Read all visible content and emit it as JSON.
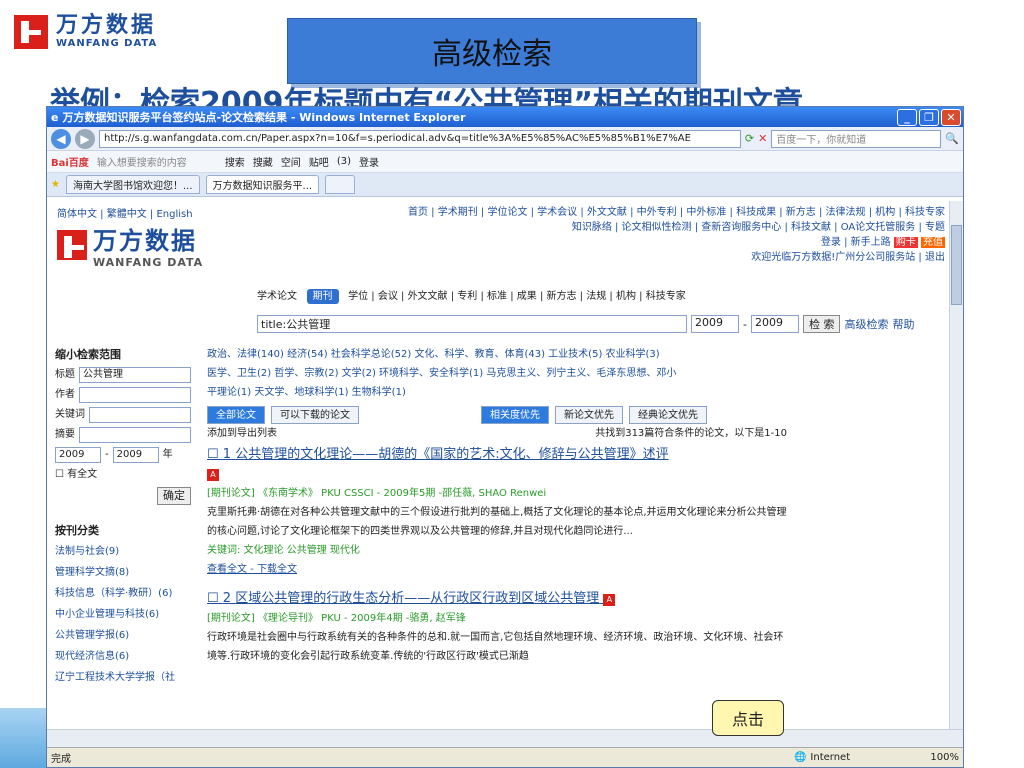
{
  "slide": {
    "logo_cn": "万方数据",
    "logo_en": "WANFANG DATA",
    "title": "高级检索",
    "subtitle": "举例：检索2009年标题中有“公共管理”相关的期刊文章"
  },
  "browser": {
    "window_title": "万方数据知识服务平台签约站点-论文检索结果 - Windows Internet Explorer",
    "url": "http://s.g.wanfangdata.com.cn/Paper.aspx?n=10&f=s.periodical.adv&q=title%3A%E5%85%AC%E5%85%B1%E7%AE",
    "search_placeholder": "百度一下，你就知道",
    "toolbar_items": [
      "Bai百度",
      "输入想要搜索的内容",
      "搜索",
      "搜藏",
      "空间",
      "贴吧",
      "(3)",
      "登录"
    ],
    "tabs": [
      "海南大学图书馆欢迎您！...",
      "万方数据知识服务平..."
    ],
    "status": "完成",
    "zone": "Internet",
    "zoom": "100%"
  },
  "site": {
    "langs": "简体中文 | 繁體中文 | English",
    "toplinks_1": "首页 | 学术期刊 | 学位论文 | 学术会议 | 外文文献 | 中外专利 | 中外标准 | 科技成果 | 新方志 | 法律法规 | 机构 | 科技专家",
    "toplinks_2": "知识脉络 | 论文相似性检测 | 查新咨询服务中心 | 科技文献 | OA论文托管服务 | 专题",
    "login": "登录",
    "newbie": "新手上路",
    "cart": "购卡",
    "recharge": "充值",
    "welcome": "欢迎光临万方数据!广州分公司服务站 | 退出",
    "channels": [
      "学术论文",
      "期刊",
      "学位",
      "会议",
      "外文文献",
      "专利",
      "标准",
      "成果",
      "新方志",
      "法规",
      "机构",
      "科技专家"
    ],
    "query": "title:公共管理",
    "year_from": "2009",
    "year_to": "2009",
    "search_btn": "检 索",
    "adv_link": "高级检索",
    "help_link": "帮助"
  },
  "sidebar": {
    "narrow_title": "缩小检索范围",
    "fields": [
      {
        "label": "标题",
        "value": "公共管理"
      },
      {
        "label": "作者",
        "value": ""
      },
      {
        "label": "关键词",
        "value": ""
      },
      {
        "label": "摘要",
        "value": ""
      }
    ],
    "year_from": "2009",
    "year_to": "2009",
    "year_unit": "年",
    "fulltext": "有全文",
    "confirm": "确定",
    "class_title": "按刊分类",
    "classes": [
      "法制与社会(9)",
      "管理科学文摘(8)",
      "科技信息（科学·教研）(6)",
      "中小企业管理与科技(6)",
      "公共管理学报(6)",
      "现代经济信息(6)",
      "辽宁工程技术大学学报（社"
    ]
  },
  "main": {
    "cat_line1": "政治、法律(140)  经济(54)  社会科学总论(52)  文化、科学、教育、体育(43)  工业技术(5)  农业科学(3)",
    "cat_line2": "医学、卫生(2)  哲学、宗教(2)  文学(2)  环境科学、安全科学(1)  马克思主义、列宁主义、毛泽东思想、邓小",
    "cat_line3": "平理论(1)  天文学、地球科学(1)  生物科学(1)",
    "tab_all": "全部论文",
    "tab_dl": "可以下载的论文",
    "sort_rel": "相关度优先",
    "sort_new": "新论文优先",
    "sort_classic": "经典论文优先",
    "export": "添加到导出列表",
    "count": "共找到313篇符合条件的论文，以下是1-10",
    "results": [
      {
        "num": "1",
        "title": "公共管理的文化理论——胡德的《国家的艺术:文化、修辞与公共管理》述评",
        "meta": "[期刊论文] 《东南学术》 PKU CSSCI - 2009年5期 -邵任薇, SHAO Renwei",
        "abstract": "克里斯托弗·胡德在对各种公共管理文献中的三个假设进行批判的基础上,概括了文化理论的基本论点,并运用文化理论来分析公共管理的核心问题,讨论了文化理论框架下的四类世界观以及公共管理的修辞,并且对现代化趋同论进行...",
        "keywords": "关键词: 文化理论  公共管理  现代化",
        "links": "查看全文 - 下载全文"
      },
      {
        "num": "2",
        "title": "区域公共管理的行政生态分析——从行政区行政到区域公共管理",
        "meta": "[期刊论文] 《理论导刊》 PKU - 2009年4期 -骆勇, 赵军锋",
        "abstract": "行政环境是社会圈中与行政系统有关的各种条件的总和.就一国而言,它包括自然地理环境、经济环境、政治环境、文化环境、社会环境等.行政环境的变化会引起行政系统变革.传统的'行政区行政'模式已渐趋"
      }
    ],
    "callout": "点击"
  }
}
